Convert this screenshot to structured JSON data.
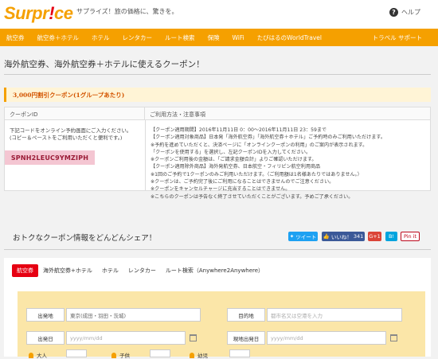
{
  "brand": {
    "logo_a": "Surpr",
    "logo_b": "!",
    "logo_c": "ce",
    "tagline": "サプライズ！旅の価格に、驚きを。"
  },
  "help": {
    "icon": "?",
    "label": "ヘルプ"
  },
  "nav": {
    "items": [
      "航空券",
      "航空券＋ホテル",
      "ホテル",
      "レンタカー",
      "ルート検索",
      "保険",
      "WiFi",
      "たびはるのWorldTravel"
    ],
    "support": "トラベル サポート"
  },
  "page": {
    "title": "海外航空券、海外航空券＋ホテルに使えるクーポン！"
  },
  "coupon": {
    "bar": "3,000円割引クーポン(1グループあたり)",
    "col_id": "クーポンID",
    "col_terms": "ご利用方法・注意事項",
    "instructions": [
      "下記コードをオンライン予約画面にご入力ください。",
      "(コピー＆ペーストをご利用いただくと便利です。)"
    ],
    "code": "SPNH2LEUC9YMZIPH",
    "terms": [
      "【クーポン適用期間】2016年11月11日 0：00～2016年11月11日 23：59まで",
      "【クーポン適用対象商品】日本発「海外航空券」「海外航空券＋ホテル」ご予約時のみご利用いただけます。",
      "※予約を進めていただくと、決済ページに「オンラインクーポンの利用」のご案内が表示されます。",
      "「クーポンを使用する」を選択し、左記クーポンIDを入力してください。",
      "※クーポンご利用後の金額は、「ご請求金額合計」よりご確認いただけます。",
      "【クーポン適用除外商品】海外発航空券、日本航空・フィリピン航空利用商品",
      "※1回のご予約で1クーポンのみご利用いただけます。（ご利用額は1名様あたりではありません。）",
      "※クーポンは、ご予約完了後にご利用になることはできませんのでご注意ください。",
      "※クーポンをキャンセルチャージに充当することはできません。",
      "※こちらのクーポンは予告なく終了させていただくことがございます。予めご了承ください。"
    ]
  },
  "share": {
    "title": "おトクなクーポン情報をどんどんシェア！",
    "tweet": "ツイート",
    "like": "いいね！",
    "like_count": "341",
    "gplus": "G+1",
    "bookmark": "B!",
    "pin": "Pin it"
  },
  "search": {
    "tabs": [
      "航空券",
      "海外航空券+ホテル",
      "ホテル",
      "レンタカー",
      "ルート検索（Anywhere2Anywhere）"
    ],
    "dep_label": "出発地",
    "dep_value": "東京(成田・羽田・茨城)",
    "dest_label": "目的地",
    "dest_placeholder": "都市名又は空港を入力",
    "dep_date_label": "出発日",
    "date_placeholder": "yyyy/mm/dd",
    "ret_date_label": "現地出発日",
    "adult": "大人",
    "child": "子供",
    "infant": "幼児"
  },
  "colors": {
    "brand_orange": "#f5a000",
    "brand_red": "#e60012",
    "code_bg": "#f4c6d2",
    "search_bg": "#fbe6a8"
  }
}
